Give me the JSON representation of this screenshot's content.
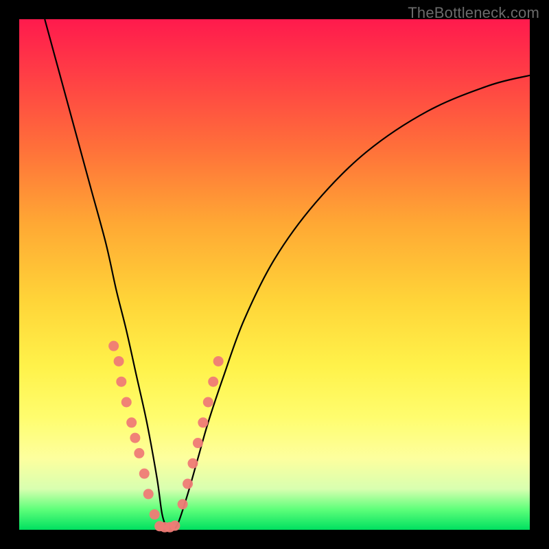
{
  "watermark": "TheBottleneck.com",
  "colors": {
    "frame": "#000000",
    "curve": "#000000",
    "dot": "#ef7b76",
    "gradient_stops": [
      "#ff1a4d",
      "#ff3b46",
      "#ff6f3a",
      "#ffa834",
      "#ffd438",
      "#fff24a",
      "#fffd6e",
      "#fdff9e",
      "#d8ffb0",
      "#5eff7a",
      "#00e060"
    ]
  },
  "chart_data": {
    "type": "line",
    "title": "",
    "xlabel": "",
    "ylabel": "",
    "xlim": [
      0,
      100
    ],
    "ylim": [
      0,
      100
    ],
    "grid": false,
    "legend": false,
    "description": "Single V-shaped bottleneck curve over vertical red-to-green gradient. Left arm descends steeply from top-left; right arm rises with decreasing slope toward upper-right. Minimum near x≈28, y≈0. Axes unlabeled; values are visual estimates on 0–100 plot coordinates (y=0 at bottom, y=100 at top).",
    "series": [
      {
        "name": "bottleneck-curve",
        "x": [
          5,
          8,
          11,
          14,
          17,
          19,
          21,
          23,
          25,
          27,
          28,
          29,
          30,
          31,
          33,
          35,
          37,
          40,
          44,
          50,
          58,
          68,
          80,
          92,
          100
        ],
        "y": [
          100,
          89,
          78,
          67,
          56,
          47,
          39,
          30,
          21,
          10,
          3,
          0.5,
          0.5,
          1,
          7,
          14,
          21,
          30,
          41,
          53,
          64,
          74,
          82,
          87,
          89
        ]
      }
    ],
    "markers": [
      {
        "name": "left-arm-dots",
        "x": [
          18.5,
          19.5,
          20,
          21,
          22,
          22.7,
          23.5,
          24.5,
          25.3,
          26.5
        ],
        "y": [
          36,
          33,
          29,
          25,
          21,
          18,
          15,
          11,
          7,
          3
        ]
      },
      {
        "name": "trough-dots",
        "x": [
          27.5,
          28.5,
          29.5,
          30.5
        ],
        "y": [
          0.7,
          0.5,
          0.5,
          0.8
        ]
      },
      {
        "name": "right-arm-dots",
        "x": [
          32,
          33,
          34,
          35,
          36,
          37,
          38,
          39
        ],
        "y": [
          5,
          9,
          13,
          17,
          21,
          25,
          29,
          33
        ]
      }
    ]
  }
}
